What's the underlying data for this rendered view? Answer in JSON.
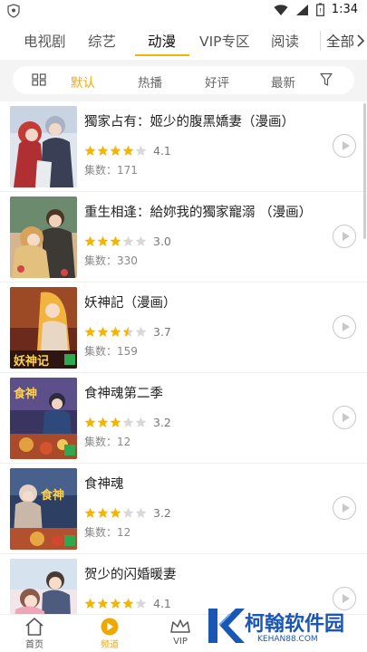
{
  "status_bar": {
    "time": "1:34",
    "icons": [
      "shield-icon",
      "wifi-icon",
      "signal-icon",
      "battery-icon"
    ]
  },
  "category_tabs": [
    {
      "label": "电视剧",
      "active": false
    },
    {
      "label": "综艺",
      "active": false
    },
    {
      "label": "动漫",
      "active": true
    },
    {
      "label": "VIP专区",
      "active": false
    },
    {
      "label": "阅读",
      "active": false
    }
  ],
  "category_all": {
    "label": "全部",
    "icon": "chevron-right-icon"
  },
  "sort_options": [
    {
      "label": "默认",
      "active": true
    },
    {
      "label": "热播",
      "active": false
    },
    {
      "label": "好评",
      "active": false
    },
    {
      "label": "最新",
      "active": false
    }
  ],
  "filter_icons": [
    "grid-icon",
    "filter-icon"
  ],
  "items": [
    {
      "title": "獨家占有：姬少的腹黑嬌妻（漫画）",
      "rating": "4.1",
      "stars": 4.0,
      "episodes": "集数：171"
    },
    {
      "title": "重生相逢：給妳我的獨家寵溺 （漫画）",
      "rating": "3.0",
      "stars": 3.0,
      "episodes": "集数：330"
    },
    {
      "title": "妖神記（漫画）",
      "rating": "3.7",
      "stars": 3.5,
      "episodes": "集数：159"
    },
    {
      "title": "食神魂第二季",
      "rating": "3.2",
      "stars": 3.0,
      "episodes": "集数：12"
    },
    {
      "title": "食神魂",
      "rating": "3.2",
      "stars": 3.0,
      "episodes": "集数：12"
    },
    {
      "title": "贺少的闪婚暖妻",
      "rating": "4.1",
      "stars": 4.0,
      "episodes": ""
    }
  ],
  "bottom_nav": [
    {
      "label": "首页",
      "icon": "home-icon",
      "active": false
    },
    {
      "label": "频道",
      "icon": "play-circle-icon",
      "active": true
    },
    {
      "label": "VIP",
      "icon": "crown-icon",
      "active": false
    }
  ],
  "watermark": {
    "text": "柯翰软件园",
    "sub": "KEHAN88.COM"
  },
  "colors": {
    "accent": "#f0a800",
    "star": "#f4b400",
    "star_empty": "#d8d8d8",
    "watermark": "#1a56b4"
  }
}
